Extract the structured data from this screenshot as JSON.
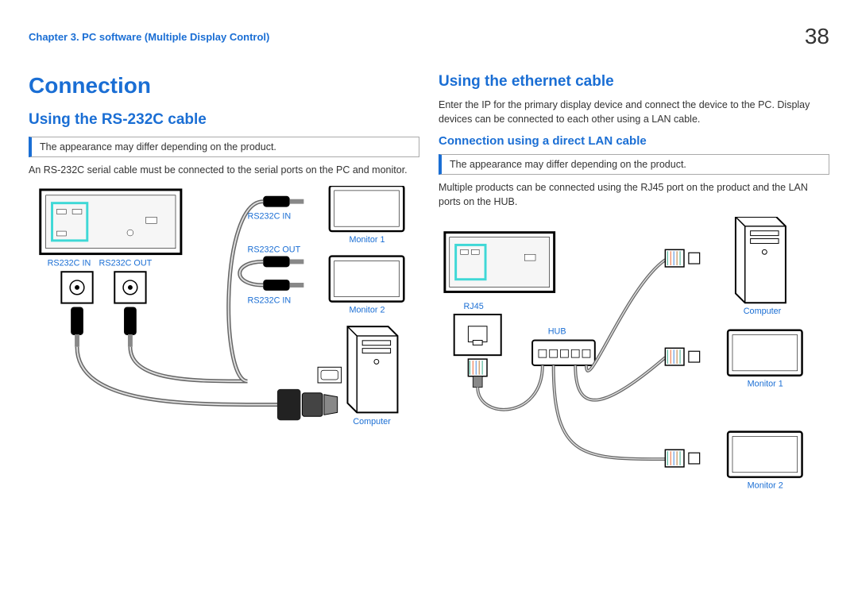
{
  "header": {
    "chapter": "Chapter 3. PC software (Multiple Display Control)",
    "page": "38"
  },
  "left": {
    "h1": "Connection",
    "h2": "Using the RS-232C cable",
    "note": "The appearance may differ depending on the product.",
    "body": "An RS-232C serial cable must be connected to the serial ports on the PC and monitor.",
    "labels": {
      "in1": "RS232C IN",
      "out1": "RS232C OUT",
      "in2": "RS232C IN",
      "out2": "RS232C OUT",
      "in3": "RS232C IN",
      "m1": "Monitor 1",
      "m2": "Monitor 2",
      "comp": "Computer"
    }
  },
  "right": {
    "h2": "Using the ethernet cable",
    "body1": "Enter the IP for the primary display device and connect the device to the PC. Display devices can be connected to each other using a LAN cable.",
    "h3": "Connection using a direct LAN cable",
    "note": "The appearance may differ depending on the product.",
    "body2": "Multiple products can be connected using the RJ45 port on the product and the LAN ports on the HUB.",
    "labels": {
      "rj45": "RJ45",
      "hub": "HUB",
      "comp": "Computer",
      "m1": "Monitor 1",
      "m2": "Monitor 2"
    }
  }
}
